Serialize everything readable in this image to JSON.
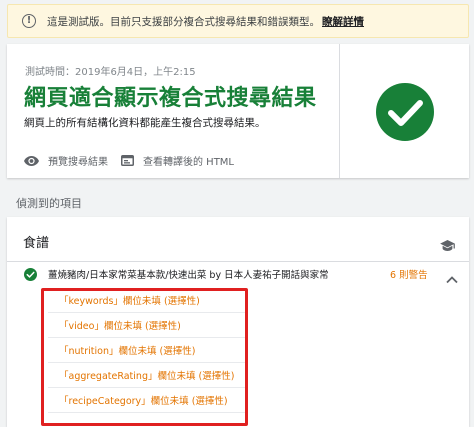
{
  "banner": {
    "message": "這是測試版。目前只支援部分複合式搜尋結果和錯誤類型。",
    "link": "瞭解詳情",
    "icon": "warning-icon"
  },
  "result_card": {
    "time_label": "測試時間：2019年6月4日，上午2:15",
    "title": "網頁適合顯示複合式搜尋結果",
    "description": "網頁上的所有結構化資料都能產生複合式搜尋結果。",
    "actions": [
      {
        "label": "預覽搜尋結果",
        "icon": "eye-icon"
      },
      {
        "label": "查看轉譯後的 HTML",
        "icon": "code-window-icon"
      }
    ],
    "status_icon": "check-circle-icon",
    "status_color": "#188038"
  },
  "detected": {
    "heading": "偵測到的項目",
    "panel_title": "食譜",
    "panel_icon": "graduation-cap-icon",
    "item": {
      "label": "薑燒豬肉/日本家常菜基本款/快速出菜 by 日本人妻祐子開話與家常",
      "warnings": "6 則警告",
      "status": "valid"
    },
    "issues": [
      "「keywords」欄位未填 (選擇性)",
      "「video」欄位未填 (選擇性)",
      "「nutrition」欄位未填 (選擇性)",
      "「aggregateRating」欄位未填 (選擇性)",
      "「recipeCategory」欄位未填 (選擇性)"
    ]
  },
  "colors": {
    "success": "#188038",
    "warning": "#e37400",
    "highlight": "#e02020",
    "banner_bg": "#fef7e0"
  }
}
